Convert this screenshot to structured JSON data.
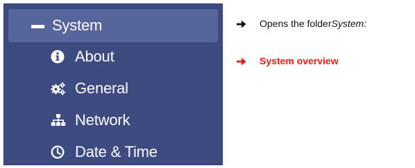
{
  "menu": {
    "header": {
      "label": "System",
      "expanded": true,
      "icon": "minus-icon"
    },
    "items": [
      {
        "label": "About",
        "icon": "info-circle-icon"
      },
      {
        "label": "General",
        "icon": "cogs-icon"
      },
      {
        "label": "Network",
        "icon": "sitemap-icon"
      },
      {
        "label": "Date & Time",
        "icon": "clock-icon"
      }
    ]
  },
  "notes": {
    "opens_folder_prefix": "Opens the folder ",
    "opens_folder_target": "System:",
    "system_overview": "System overview"
  },
  "colors": {
    "panel_bg": "#3e4b80",
    "header_bg": "#56659b",
    "text_light": "#ffffff",
    "note_text": "#111111",
    "highlight_red": "#e01c1c"
  }
}
